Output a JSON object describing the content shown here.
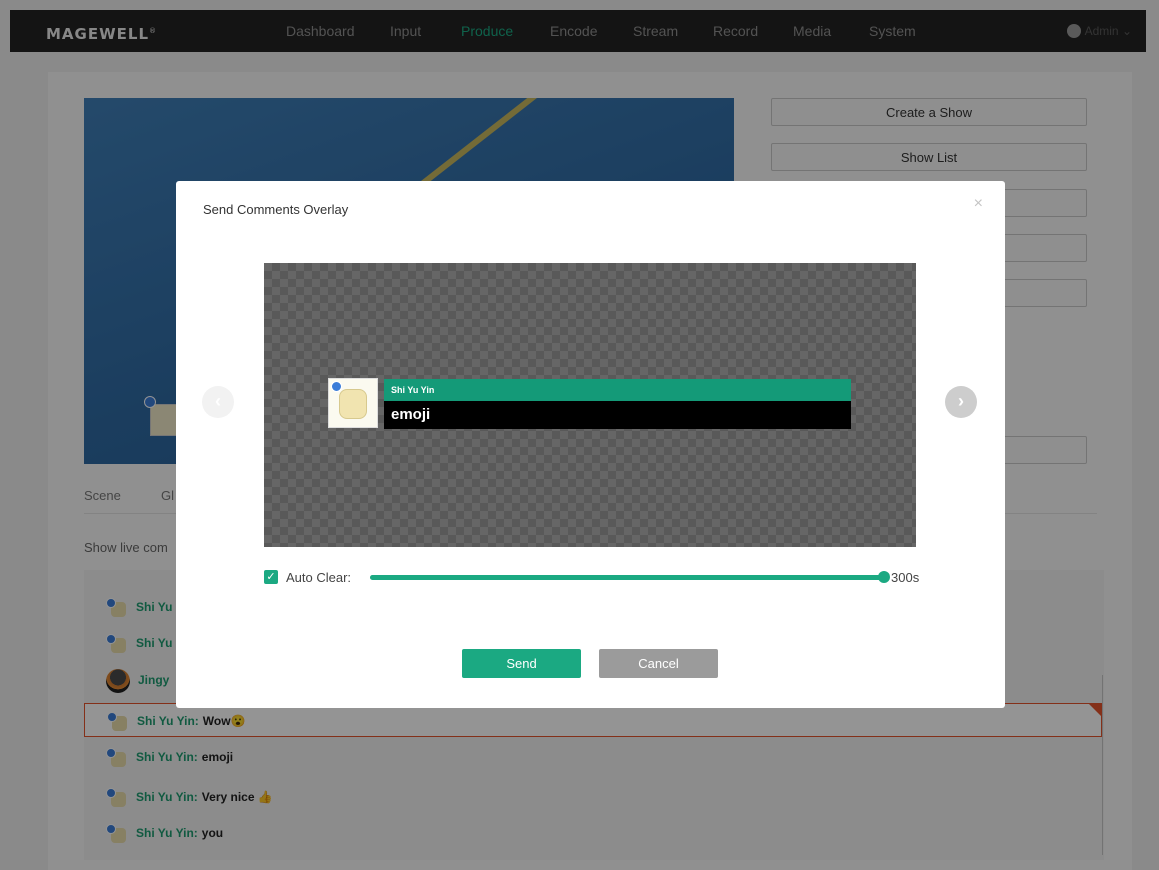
{
  "app": {
    "logo": "MAGEWELL",
    "logo_mark": "®"
  },
  "nav": {
    "items": [
      {
        "label": "Dashboard"
      },
      {
        "label": "Input"
      },
      {
        "label": "Produce"
      },
      {
        "label": "Encode"
      },
      {
        "label": "Stream"
      },
      {
        "label": "Record"
      },
      {
        "label": "Media"
      },
      {
        "label": "System"
      }
    ],
    "active": "Produce",
    "user": "Admin",
    "user_chevron": "⌄"
  },
  "sidebar": {
    "create_show": "Create a Show",
    "show_list": "Show List"
  },
  "tabs": {
    "scene": "Scene",
    "second_partial": "Gl"
  },
  "live_comments_label": "Show live com",
  "comments": [
    {
      "name": "Shi Yu",
      "text": ""
    },
    {
      "name": "Shi Yu",
      "text": ""
    },
    {
      "name": "Jingy",
      "text": ""
    },
    {
      "name": "Shi Yu Yin:",
      "text": "Wow😮"
    },
    {
      "name": "Shi Yu Yin:",
      "text": "emoji"
    },
    {
      "name": "Shi Yu Yin:",
      "text": "Very nice 👍"
    },
    {
      "name": "Shi Yu Yin:",
      "text": "you"
    }
  ],
  "modal": {
    "title": "Send Comments Overlay",
    "close_symbol": "×",
    "preview": {
      "name": "Shi Yu Yin",
      "text": "emoji"
    },
    "prev_symbol": "‹",
    "next_symbol": "›",
    "auto_clear": {
      "label": "Auto Clear:",
      "checked": true,
      "check_symbol": "✓",
      "value_text": "300s",
      "fraction": 1.0
    },
    "send_label": "Send",
    "cancel_label": "Cancel"
  },
  "colors": {
    "accent": "#1ba982",
    "selection_border": "#e4542c",
    "nav_bg": "#232323"
  },
  "icons": {
    "user": "user-icon",
    "close": "close-icon",
    "prev": "chevron-left-icon",
    "next": "chevron-right-icon",
    "check": "check-icon"
  }
}
